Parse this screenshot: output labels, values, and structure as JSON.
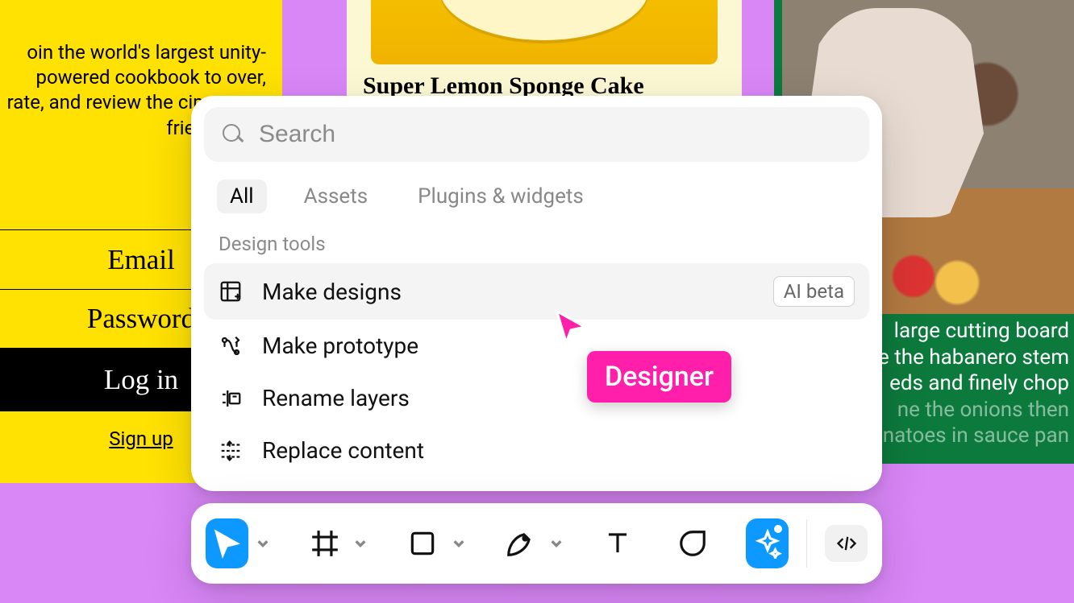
{
  "background": {
    "intro_text": "oin the world's largest unity-powered cookbook to over, rate, and review the cipes your friends love",
    "email_label": "Email",
    "password_label": "Password",
    "login_label": "Log in",
    "signup_label": "Sign up",
    "recipe_title": "Super Lemon Sponge Cake",
    "green_caption_line1": "large cutting board",
    "green_caption_line2": "e the habanero stem",
    "green_caption_line3": "eds and finely chop",
    "green_caption_fade1": "ne the onions then",
    "green_caption_fade2": "natoes in sauce pan"
  },
  "search": {
    "placeholder": "Search",
    "tabs": {
      "all": "All",
      "assets": "Assets",
      "plugins": "Plugins & widgets"
    },
    "section": "Design tools",
    "items": {
      "make_designs": "Make designs",
      "make_prototype": "Make prototype",
      "rename_layers": "Rename layers",
      "replace_content": "Replace content"
    },
    "badge": "AI beta"
  },
  "cursor_label": "Designer",
  "toolbar": {
    "move": "move-tool",
    "frame": "frame-tool",
    "shape": "rectangle-tool",
    "pen": "pen-tool",
    "text": "text-tool",
    "comment": "comment-tool",
    "ai": "ai-actions",
    "dev": "dev-mode"
  }
}
